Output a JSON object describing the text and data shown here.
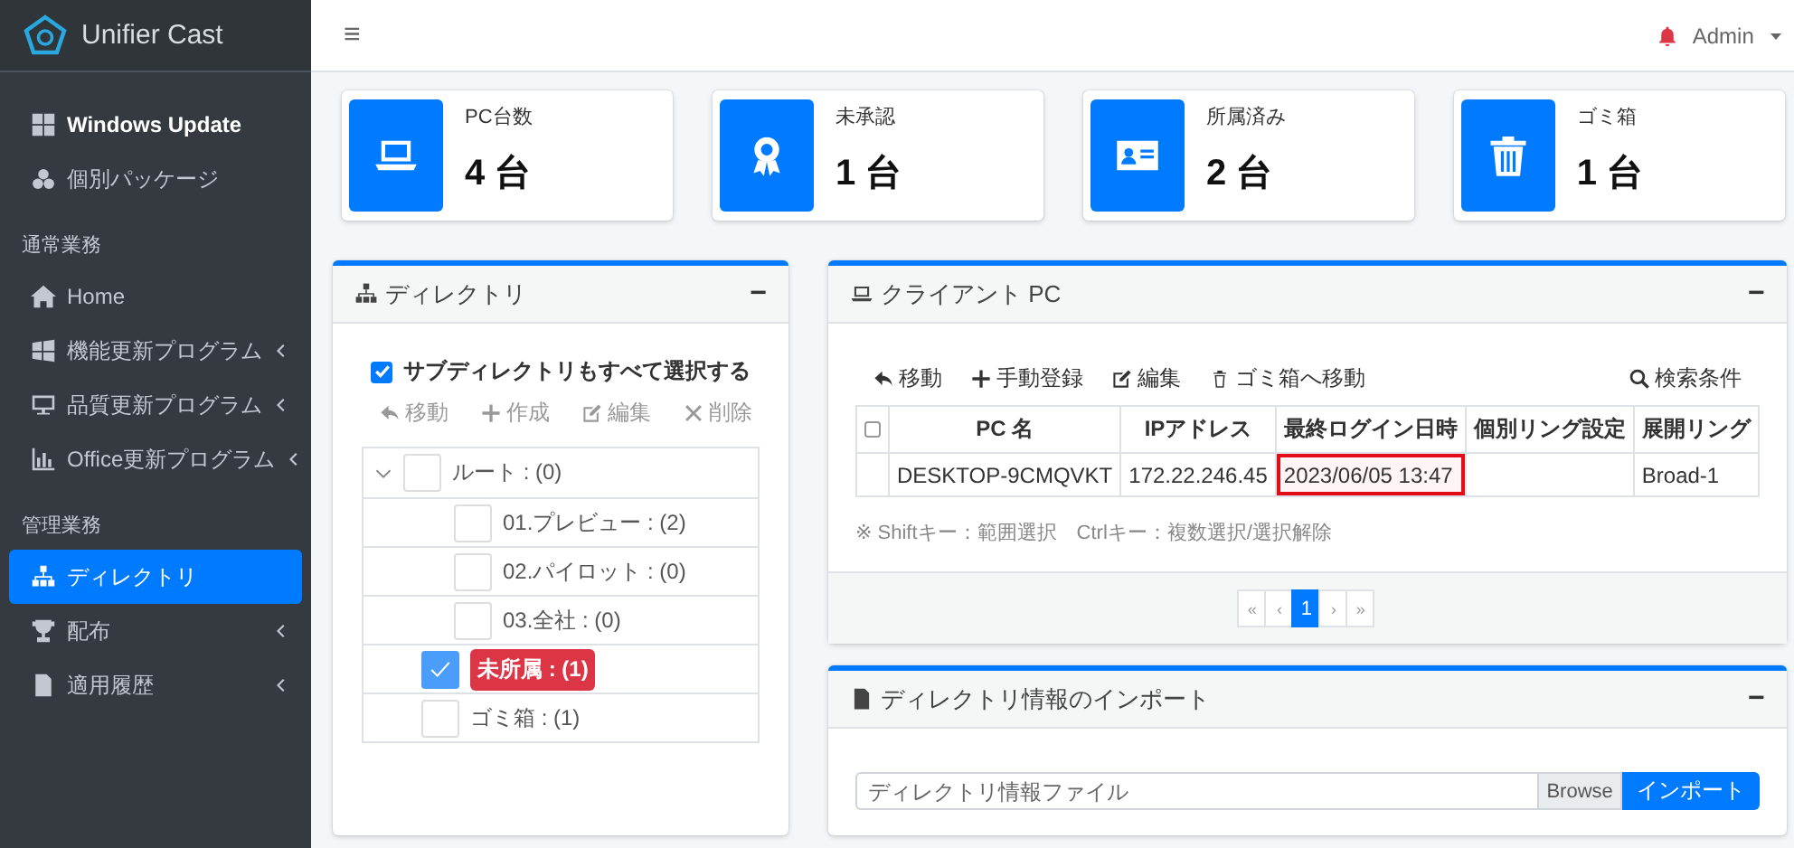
{
  "brand": {
    "name": "Unifier Cast"
  },
  "sidebar": {
    "top_items": [
      {
        "label": "Windows Update",
        "selected": false,
        "bold": true
      },
      {
        "label": "個別パッケージ",
        "selected": false,
        "bold": false
      }
    ],
    "sections": [
      {
        "header": "通常業務",
        "items": [
          {
            "label": "Home",
            "submenu": false,
            "selected": false
          },
          {
            "label": "機能更新プログラム",
            "submenu": true,
            "selected": false
          },
          {
            "label": "品質更新プログラム",
            "submenu": true,
            "selected": false
          },
          {
            "label": "Office更新プログラム",
            "submenu": true,
            "selected": false
          }
        ]
      },
      {
        "header": "管理業務",
        "items": [
          {
            "label": "ディレクトリ",
            "submenu": false,
            "selected": true
          },
          {
            "label": "配布",
            "submenu": true,
            "selected": false
          },
          {
            "label": "適用履歴",
            "submenu": true,
            "selected": false
          }
        ]
      }
    ]
  },
  "topbar": {
    "menu": "≡",
    "user": "Admin"
  },
  "stats": [
    {
      "label": "PC台数",
      "value": "4 台"
    },
    {
      "label": "未承認",
      "value": "1 台"
    },
    {
      "label": "所属済み",
      "value": "2 台"
    },
    {
      "label": "ゴミ箱",
      "value": "1 台"
    }
  ],
  "directory_panel": {
    "title": "ディレクトリ",
    "collapse": "−",
    "include_sub": {
      "label": "サブディレクトリもすべて選択する",
      "checked": true
    },
    "actions": [
      "移動",
      "作成",
      "編集",
      "削除"
    ],
    "tree": [
      {
        "label": "ルート : (0)",
        "checked": false,
        "selected": false,
        "expanded": true,
        "children": [
          {
            "label": "01.プレビュー : (2)",
            "checked": false,
            "selected": false
          },
          {
            "label": "02.パイロット : (0)",
            "checked": false,
            "selected": false
          },
          {
            "label": "03.全社 : (0)",
            "checked": false,
            "selected": false
          }
        ]
      },
      {
        "label": "未所属 : (1)",
        "checked": true,
        "selected": true
      },
      {
        "label": "ゴミ箱 : (1)",
        "checked": false,
        "selected": false
      }
    ]
  },
  "client_panel": {
    "title": "クライアント PC",
    "collapse": "−",
    "actions": [
      "移動",
      "手動登録",
      "編集",
      "ゴミ箱へ移動"
    ],
    "search": "検索条件",
    "table": {
      "select_all": false,
      "columns": [
        "PC 名",
        "IPアドレス",
        "最終ログイン日時",
        "個別リング設定",
        "展開リング"
      ],
      "rows": [
        {
          "checked": false,
          "cells": [
            {
              "text": "DESKTOP-9CMQVKT",
              "highlighted": false
            },
            {
              "text": "172.22.246.45",
              "highlighted": false
            },
            {
              "text": "2023/06/05 13:47",
              "highlighted": true
            },
            {
              "text": "",
              "highlighted": false
            },
            {
              "text": "Broad-1",
              "highlighted": false
            }
          ]
        }
      ]
    },
    "note": "※ Shiftキー：範囲選択　Ctrlキー：複数選択/選択解除",
    "pagination": [
      {
        "label": "«",
        "selected": false
      },
      {
        "label": "‹",
        "selected": false
      },
      {
        "label": "1",
        "selected": true
      },
      {
        "label": "›",
        "selected": false
      },
      {
        "label": "»",
        "selected": false
      }
    ]
  },
  "import_panel": {
    "title": "ディレクトリ情報のインポート",
    "collapse": "−",
    "placeholder": "ディレクトリ情報ファイル",
    "browse": "Browse",
    "submit": "インポート"
  }
}
